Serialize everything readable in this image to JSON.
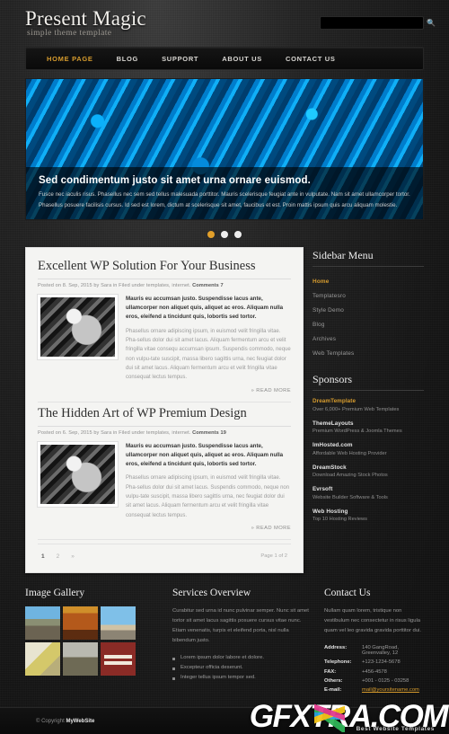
{
  "header": {
    "logo": "Present Magic",
    "tagline": "simple theme template",
    "search_placeholder": "",
    "search_value": "",
    "search_icon": "search-icon"
  },
  "nav": {
    "items": [
      {
        "label": "HOME PAGE",
        "active": true
      },
      {
        "label": "BLOG",
        "active": false
      },
      {
        "label": "SUPPORT",
        "active": false
      },
      {
        "label": "ABOUT US",
        "active": false
      },
      {
        "label": "CONTACT US",
        "active": false
      }
    ]
  },
  "slider": {
    "title": "Sed condimentum justo sit amet urna ornare euismod.",
    "desc_line1": "Fusce nec iaculis risus. Phasellus nec sem sed tellus malesuada porttitor. Mauris scelerisque feugiat ante in vulputate. Nam sit amet ullamcorper tortor.",
    "desc_line2": "Phasellus posuere facilisis cursus. Id sed est lorem, dictum at scelerisque sit amet, faucibus et est. Proin mattis ipsum quis arcu aliquam molestie.",
    "dots": [
      {
        "active": true
      },
      {
        "active": false
      },
      {
        "active": false
      }
    ]
  },
  "posts": [
    {
      "title": "Excellent WP Solution For Your Business",
      "meta_prefix": "Posted on 8. Sep, 2015 by Sara in Filed under templates, internet.",
      "meta_comments_label": "Comments",
      "meta_comments_count": "7",
      "lead": "Mauris eu accumsan justo. Suspendisse lacus ante, ullamcorper non aliquet quis, aliquet ac eros. Aliquam nulla eros, eleifend a tincidunt quis, lobortis sed tortor.",
      "para": "Phasellus ornare adipiscing ipsum, in euismod velit fringilla vitae. Pha-sellus dolor dui sit amet lacus. Aliquam fermentum arcu et velit fringilla vitae consequ accumsan ipsum. Suspendis commodo, neque non vulpu-tate suscipit, massa libero sagittis urna, nec feugiat dolor dui sit amet lacus. Aliquam fermentum arcu et velit fringilla vitae consequat lectus tempus.",
      "read_more": "» READ MORE",
      "thumbnail": "post-thumbnail-woman"
    },
    {
      "title": "The Hidden Art of WP Premium Design",
      "meta_prefix": "Posted on 6. Sep, 2015 by Sara in Filed under templates, internet.",
      "meta_comments_label": "Comments",
      "meta_comments_count": "19",
      "lead": "Mauris eu accumsan justo. Suspendisse lacus ante, ullamcorper non aliquet quis, aliquet ac eros. Aliquam nulla eros, eleifend a tincidunt quis, lobortis sed tortor.",
      "para": "Phasellus ornare adipiscing ipsum, in euismod velit fringilla vitae. Pha-sellus dolor dui sit amet lacus. Suspendis commodo, neque non vulpu-tate suscipit, massa libero sagittis urna, nec feugiat dolor dui sit amet lacus. Aliquam fermentum arcu et velit fringilla vitae consequat lectus tempus.",
      "read_more": "» READ MORE",
      "thumbnail": "post-thumbnail-portrait"
    }
  ],
  "pagination": {
    "pages": [
      {
        "label": "1",
        "current": true
      },
      {
        "label": "2",
        "current": false
      },
      {
        "label": "»",
        "current": false
      }
    ],
    "info": "Page 1 of 2"
  },
  "sidebar": {
    "menu_title": "Sidebar Menu",
    "menu_items": [
      {
        "label": "Home",
        "active": true
      },
      {
        "label": "Templatesro",
        "active": false
      },
      {
        "label": "Style Demo",
        "active": false
      },
      {
        "label": "Blog",
        "active": false
      },
      {
        "label": "Archives",
        "active": false
      },
      {
        "label": "Web Templates",
        "active": false
      }
    ],
    "sponsors_title": "Sponsors",
    "sponsors": [
      {
        "name": "DreamTemplate",
        "desc": "Over 6,000+ Premium Web Templates",
        "gold": true
      },
      {
        "name": "ThemeLayouts",
        "desc": "Premium WordPress & Joomla Themes",
        "gold": false
      },
      {
        "name": "ImHosted.com",
        "desc": "Affordable Web Hosting Provider",
        "gold": false
      },
      {
        "name": "DreamStock",
        "desc": "Download Amazing Stock Photos",
        "gold": false
      },
      {
        "name": "Evrsoft",
        "desc": "Website Builder Software & Tools",
        "gold": false
      },
      {
        "name": "Web Hosting",
        "desc": "Top 10 Hosting Reviews",
        "gold": false
      }
    ]
  },
  "footer": {
    "gallery": {
      "title": "Image Gallery",
      "thumbs": [
        "gallery-thumb-city",
        "gallery-thumb-canyon",
        "gallery-thumb-road",
        "gallery-thumb-flowers",
        "gallery-thumb-art",
        "gallery-thumb-velvet"
      ]
    },
    "services": {
      "title": "Services Overview",
      "text": "Curabitur sed urna id nunc pulvinar semper. Nunc sit amet tortor sit amet lacus sagittis posuere cursus vitae nunc. Etiam venenatis, turpis et eleifend porta, nisl nulla bibendum justo.",
      "items": [
        "Lorem ipsum dolor labore et dolore.",
        "Excepteur officia deserunt.",
        "Integer tellus ipsum tempor sed."
      ]
    },
    "contact": {
      "title": "Contact Us",
      "text": "Nullam quam lorem, tristique non vestibulum nec consectetur in risus ligula quam vel leo gravida gravida porttitor dui.",
      "rows": [
        {
          "key": "Address:",
          "value": "140 GangRoad, Greenvalley, 12",
          "mail": false
        },
        {
          "key": "Telephone:",
          "value": "+123-1234-5678",
          "mail": false
        },
        {
          "key": "FAX:",
          "value": "+456-4578",
          "mail": false
        },
        {
          "key": "Others:",
          "value": "+001 - 0125 - 03258",
          "mail": false
        },
        {
          "key": "E-mail:",
          "value": "mail@yoursitename.com",
          "mail": true
        }
      ]
    },
    "copyright_prefix": "© Copyright",
    "copyright_site": "MyWebSite"
  },
  "watermark": {
    "text": "GFXTRA.COM",
    "subtitle": "Best Website Templates"
  },
  "colors": {
    "accent_gold": "#d79c2e",
    "page_bg": "#141414",
    "content_bg": "#f4f4f2"
  }
}
